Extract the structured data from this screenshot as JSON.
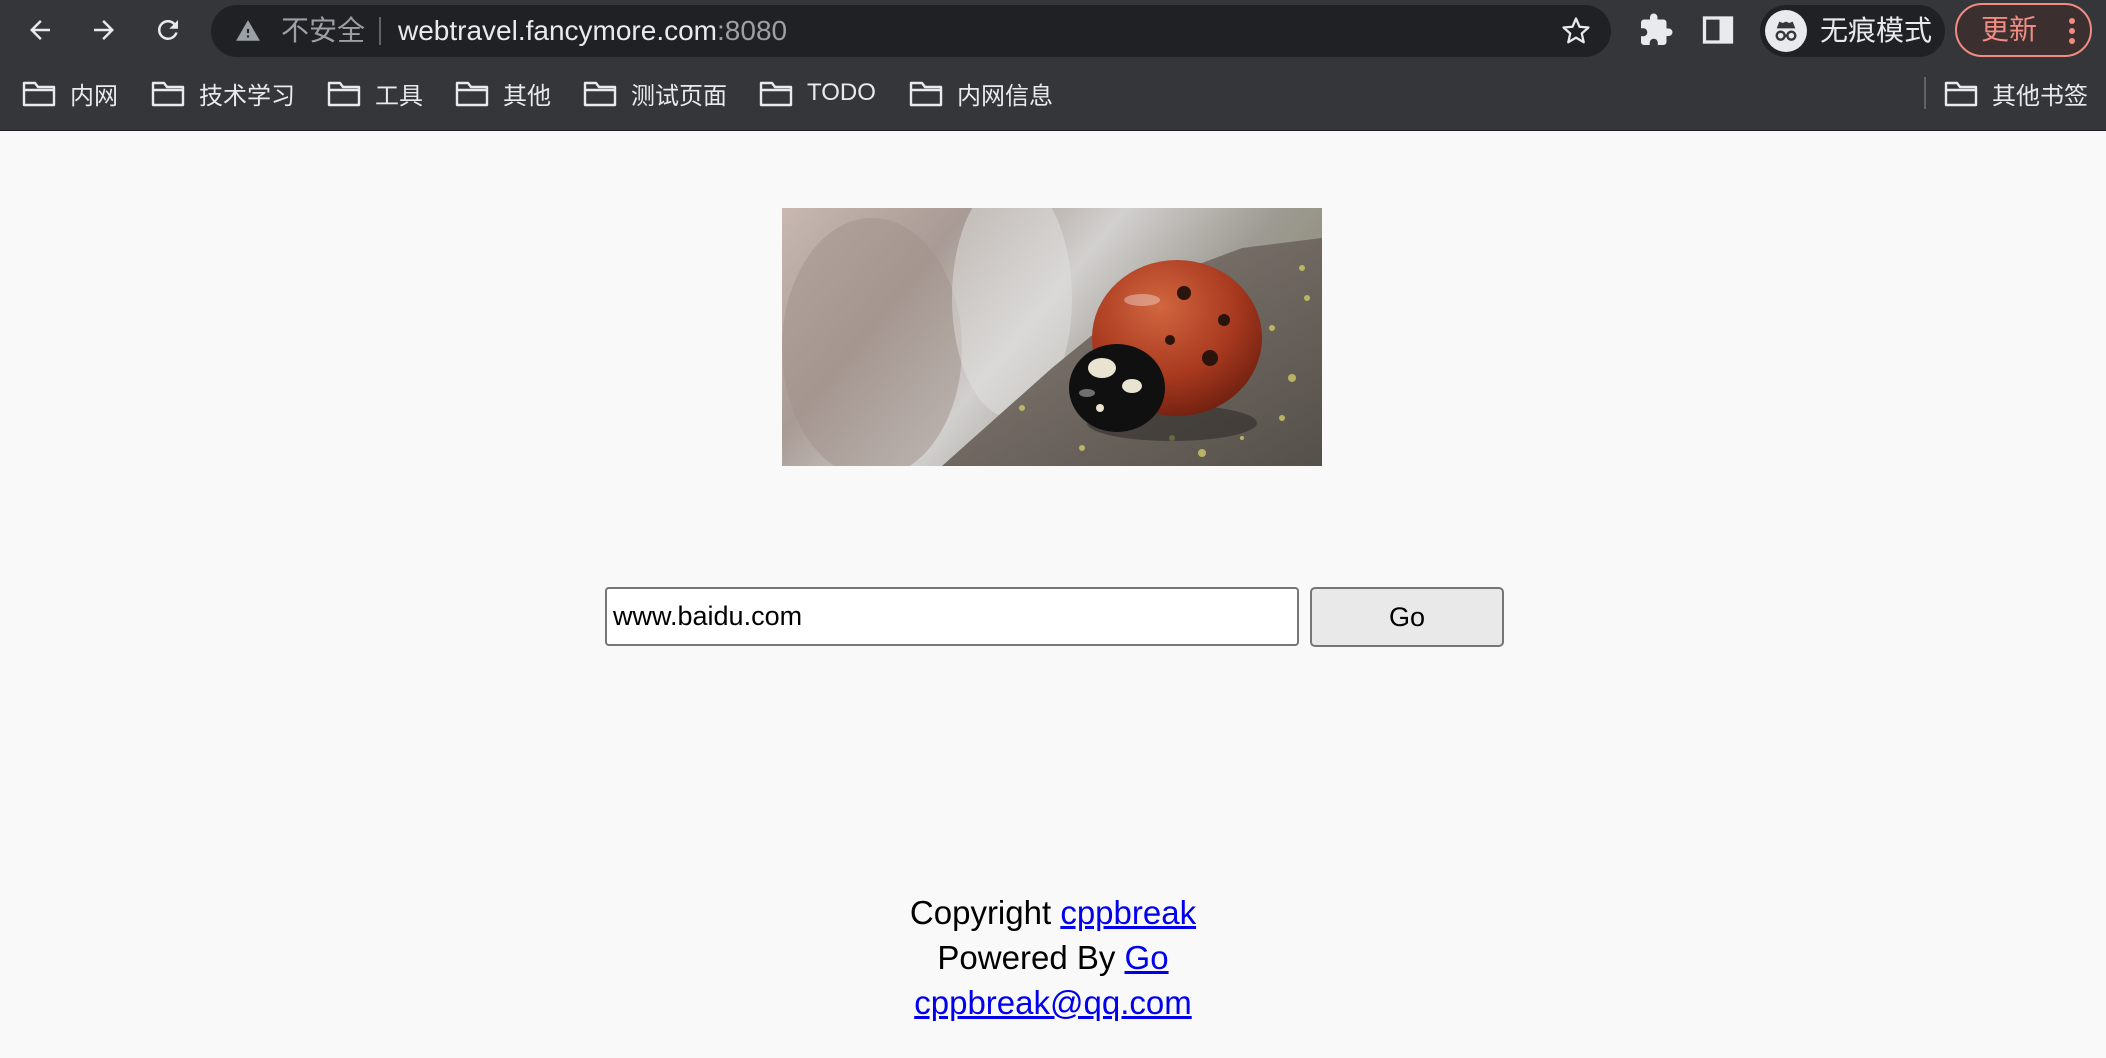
{
  "browser": {
    "security_label": "不安全",
    "url_host": "webtravel.fancymore.com",
    "url_port": ":8080",
    "incognito_label": "无痕模式",
    "update_label": "更新",
    "bookmarks": [
      "内网",
      "技术学习",
      "工具",
      "其他",
      "测试页面",
      "TODO",
      "内网信息"
    ],
    "other_bookmarks": "其他书签"
  },
  "search": {
    "value": "www.baidu.com",
    "button_label": "Go"
  },
  "footer": {
    "copyright_prefix": "Copyright",
    "copyright_link": "cppbreak",
    "powered_prefix": "Powered By",
    "powered_link": "Go",
    "email": "cppbreak@qq.com"
  }
}
